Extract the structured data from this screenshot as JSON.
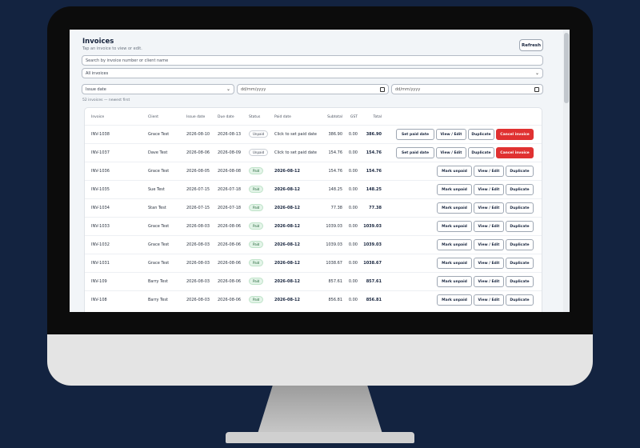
{
  "header": {
    "title": "Invoices",
    "subtitle": "Tap an invoice to view or edit.",
    "refresh_label": "Refresh"
  },
  "search": {
    "placeholder": "Search by invoice number or client name"
  },
  "filter": {
    "value": "All invoices"
  },
  "date_filter": {
    "field": "Issue date",
    "from_placeholder": "dd/mm/yyyy",
    "to_placeholder": "dd/mm/yyyy"
  },
  "count_text": "52 invoices — newest first",
  "table": {
    "columns": [
      "Invoice",
      "Client",
      "Issue date",
      "Due date",
      "Status",
      "Paid date",
      "Subtotal",
      "GST",
      "Total"
    ],
    "rows": [
      {
        "invoice": "INV-1038",
        "client": "Grace Test",
        "issue": "2026-08-10",
        "due": "2026-08-13",
        "status": "Unpaid",
        "paid": "Click to set paid date",
        "subtotal": "386.90",
        "gst": "0.00",
        "total": "386.90",
        "actions": [
          "Set paid date",
          "View / Edit",
          "Duplicate",
          "Cancel invoice"
        ]
      },
      {
        "invoice": "INV-1037",
        "client": "Dave Test",
        "issue": "2026-08-06",
        "due": "2026-08-09",
        "status": "Unpaid",
        "paid": "Click to set paid date",
        "subtotal": "154.76",
        "gst": "0.00",
        "total": "154.76",
        "actions": [
          "Set paid date",
          "View / Edit",
          "Duplicate",
          "Cancel invoice"
        ]
      },
      {
        "invoice": "INV-1036",
        "client": "Grace Test",
        "issue": "2026-08-05",
        "due": "2026-08-08",
        "status": "Paid",
        "paid": "2026-08-12",
        "subtotal": "154.76",
        "gst": "0.00",
        "total": "154.76",
        "actions": [
          "Mark unpaid",
          "View / Edit",
          "Duplicate"
        ]
      },
      {
        "invoice": "INV-1035",
        "client": "Sue Test",
        "issue": "2026-07-15",
        "due": "2026-07-18",
        "status": "Paid",
        "paid": "2026-08-12",
        "subtotal": "148.25",
        "gst": "0.00",
        "total": "148.25",
        "actions": [
          "Mark unpaid",
          "View / Edit",
          "Duplicate"
        ]
      },
      {
        "invoice": "INV-1034",
        "client": "Stan Test",
        "issue": "2026-07-15",
        "due": "2026-07-18",
        "status": "Paid",
        "paid": "2026-08-12",
        "subtotal": "77.38",
        "gst": "0.00",
        "total": "77.38",
        "actions": [
          "Mark unpaid",
          "View / Edit",
          "Duplicate"
        ]
      },
      {
        "invoice": "INV-1033",
        "client": "Grace Test",
        "issue": "2026-08-03",
        "due": "2026-08-06",
        "status": "Paid",
        "paid": "2026-08-12",
        "subtotal": "1039.03",
        "gst": "0.00",
        "total": "1039.03",
        "actions": [
          "Mark unpaid",
          "View / Edit",
          "Duplicate"
        ]
      },
      {
        "invoice": "INV-1032",
        "client": "Grace Test",
        "issue": "2026-08-03",
        "due": "2026-08-06",
        "status": "Paid",
        "paid": "2026-08-12",
        "subtotal": "1039.03",
        "gst": "0.00",
        "total": "1039.03",
        "actions": [
          "Mark unpaid",
          "View / Edit",
          "Duplicate"
        ]
      },
      {
        "invoice": "INV-1031",
        "client": "Grace Test",
        "issue": "2026-08-03",
        "due": "2026-08-06",
        "status": "Paid",
        "paid": "2026-08-12",
        "subtotal": "1038.67",
        "gst": "0.00",
        "total": "1038.67",
        "actions": [
          "Mark unpaid",
          "View / Edit",
          "Duplicate"
        ]
      },
      {
        "invoice": "INV-109",
        "client": "Barry Test",
        "issue": "2026-08-03",
        "due": "2026-08-06",
        "status": "Paid",
        "paid": "2026-08-12",
        "subtotal": "857.61",
        "gst": "0.00",
        "total": "857.61",
        "actions": [
          "Mark unpaid",
          "View / Edit",
          "Duplicate"
        ]
      },
      {
        "invoice": "INV-108",
        "client": "Barry Test",
        "issue": "2026-08-03",
        "due": "2026-08-06",
        "status": "Paid",
        "paid": "2026-08-12",
        "subtotal": "856.81",
        "gst": "0.00",
        "total": "856.81",
        "actions": [
          "Mark unpaid",
          "View / Edit",
          "Duplicate"
        ]
      }
    ]
  },
  "colors": {
    "background": "#132340",
    "accent": "#16233c",
    "danger": "#e03131",
    "paid_badge": "#e3f4e8"
  },
  "icons": {
    "select": "chevron-down-icon",
    "date": "calendar-icon"
  }
}
